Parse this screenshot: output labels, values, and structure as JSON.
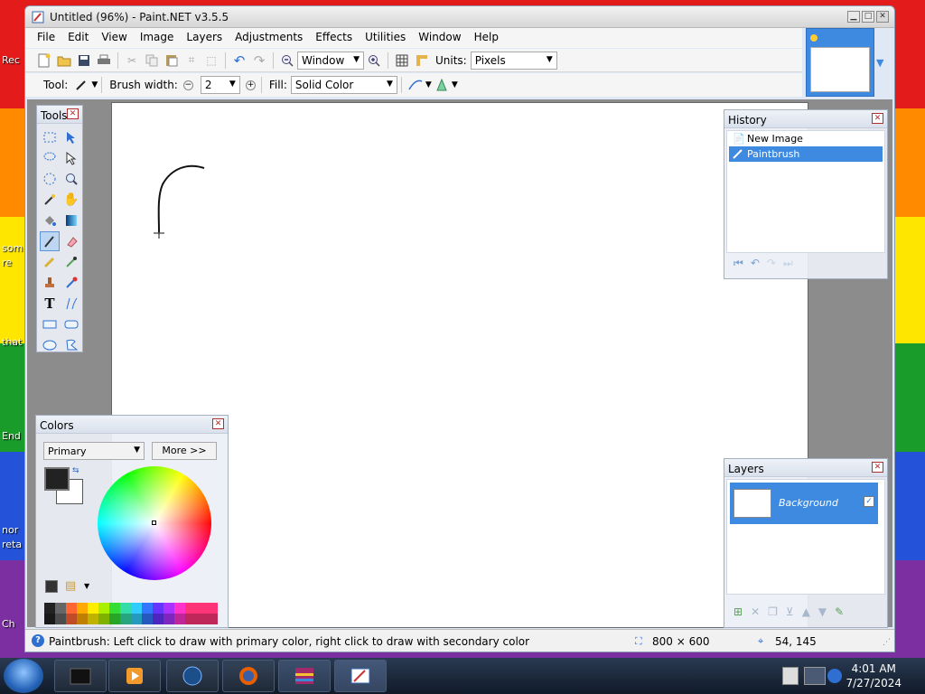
{
  "desktop": {
    "labels": [
      "Rec",
      "som",
      "re",
      "that",
      "End",
      "nor",
      "reta",
      "Ch"
    ]
  },
  "window": {
    "title": "Untitled (96%) - Paint.NET v3.5.5"
  },
  "menu": [
    "File",
    "Edit",
    "View",
    "Image",
    "Layers",
    "Adjustments",
    "Effects",
    "Utilities",
    "Window",
    "Help"
  ],
  "toolbar1": {
    "zoom_value": "Window",
    "units_label": "Units:",
    "units_value": "Pixels"
  },
  "toolbar2": {
    "tool_label": "Tool:",
    "brush_label": "Brush width:",
    "brush_value": "2",
    "fill_label": "Fill:",
    "fill_value": "Solid Color"
  },
  "tools_panel": {
    "title": "Tools",
    "tools": [
      "rectangle-select-icon",
      "move-selection-icon",
      "lasso-select-icon",
      "move-selected-icon",
      "ellipse-select-icon",
      "zoom-icon",
      "magic-wand-icon",
      "pan-icon",
      "paint-bucket-icon",
      "gradient-icon",
      "paintbrush-icon",
      "eraser-icon",
      "pencil-icon",
      "color-picker-icon",
      "clone-stamp-icon",
      "recolor-icon",
      "text-icon",
      "line-curve-icon",
      "rectangle-icon",
      "rounded-rectangle-icon",
      "ellipse-icon",
      "freeform-shape-icon"
    ],
    "active": "paintbrush-icon"
  },
  "colors_panel": {
    "title": "Colors",
    "select_value": "Primary",
    "more_label": "More >>",
    "primary": "#222222",
    "secondary": "#ffffff"
  },
  "history_panel": {
    "title": "History",
    "items": [
      "New Image",
      "Paintbrush"
    ],
    "selected": 1
  },
  "layers_panel": {
    "title": "Layers",
    "layer_name": "Background",
    "checkbox": "✓"
  },
  "statusbar": {
    "message": "Paintbrush: Left click to draw with primary color, right click to draw with secondary color",
    "image_size": "800 × 600",
    "cursor_pos": "54, 145"
  },
  "taskbar": {
    "time": "4:01 AM",
    "date": "7/27/2024"
  },
  "colors": {
    "accent": "#3d8ae0"
  }
}
